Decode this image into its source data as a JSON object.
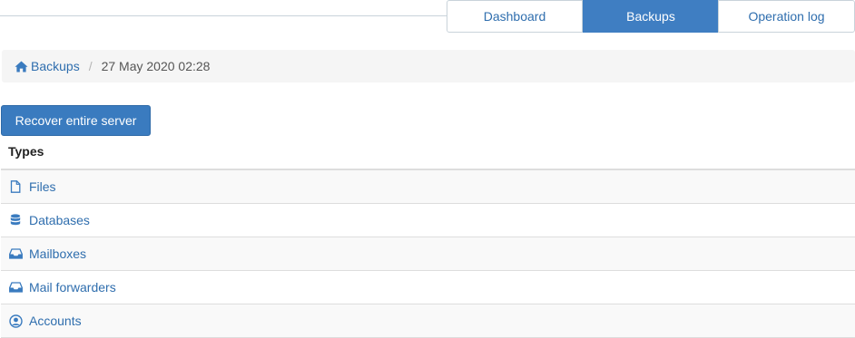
{
  "tabs": [
    {
      "label": "Dashboard",
      "active": false
    },
    {
      "label": "Backups",
      "active": true
    },
    {
      "label": "Operation log",
      "active": false
    }
  ],
  "breadcrumb": {
    "home_icon": "home-icon",
    "root_label": "Backups",
    "separator": "/",
    "current": "27 May 2020 02:28"
  },
  "actions": {
    "recover_label": "Recover entire server"
  },
  "types": {
    "heading": "Types",
    "items": [
      {
        "label": "Files",
        "icon": "file-icon"
      },
      {
        "label": "Databases",
        "icon": "database-icon"
      },
      {
        "label": "Mailboxes",
        "icon": "inbox-icon"
      },
      {
        "label": "Mail forwarders",
        "icon": "inbox-icon"
      },
      {
        "label": "Accounts",
        "icon": "user-circle-icon"
      }
    ]
  },
  "colors": {
    "accent": "#3f7ec2",
    "link": "#2f6eae"
  }
}
